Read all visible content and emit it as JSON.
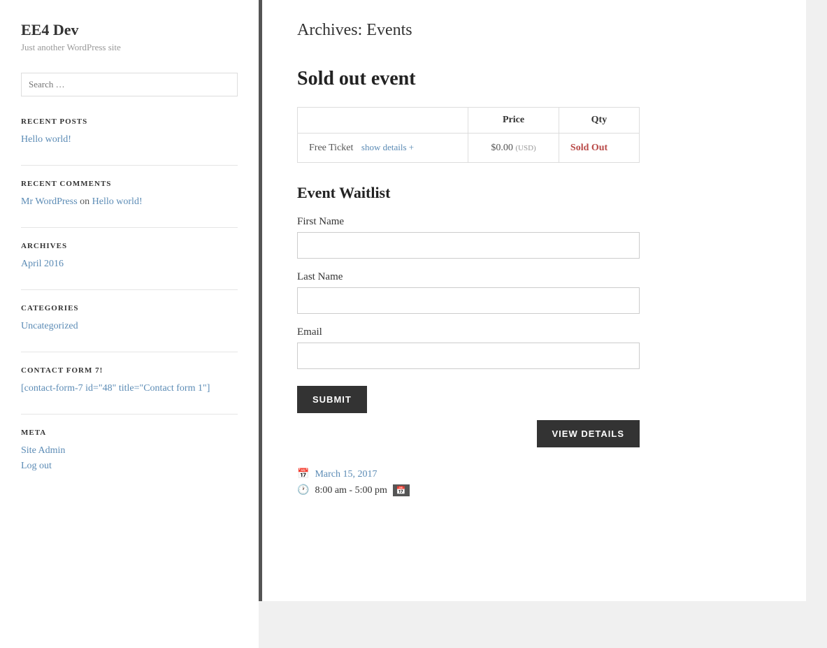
{
  "site": {
    "title": "EE4 Dev",
    "tagline": "Just another WordPress site"
  },
  "sidebar": {
    "search_placeholder": "Search …",
    "recent_posts_label": "RECENT POSTS",
    "recent_posts": [
      {
        "label": "Hello world!",
        "href": "#"
      }
    ],
    "recent_comments_label": "RECENT COMMENTS",
    "recent_comments": [
      {
        "author": "Mr WordPress",
        "on": "on",
        "post": "Hello world!",
        "post_href": "#"
      }
    ],
    "archives_label": "ARCHIVES",
    "archives": [
      {
        "label": "April 2016",
        "href": "#"
      }
    ],
    "categories_label": "CATEGORIES",
    "categories": [
      {
        "label": "Uncategorized",
        "href": "#"
      }
    ],
    "contact_form_label": "CONTACT FORM 7!",
    "contact_form_code": "[contact-form-7 id=\"48\" title=\"Contact form 1\"]",
    "meta_label": "META",
    "meta_links": [
      {
        "label": "Site Admin",
        "href": "#"
      },
      {
        "label": "Log out",
        "href": "#"
      }
    ]
  },
  "main": {
    "archive_title": "Archives: Events",
    "event_title": "Sold out event",
    "ticket_table": {
      "col_price": "Price",
      "col_qty": "Qty",
      "row": {
        "name": "Free Ticket",
        "show_details": "show details +",
        "price": "$0.00",
        "currency": "(USD)",
        "qty": "Sold Out"
      }
    },
    "waitlist": {
      "title": "Event Waitlist",
      "first_name_label": "First Name",
      "last_name_label": "Last Name",
      "email_label": "Email",
      "submit_label": "SUBMIT"
    },
    "view_details_label": "VIEW DETAILS",
    "event_date": "March 15, 2017",
    "event_time": "8:00 am - 5:00 pm"
  }
}
